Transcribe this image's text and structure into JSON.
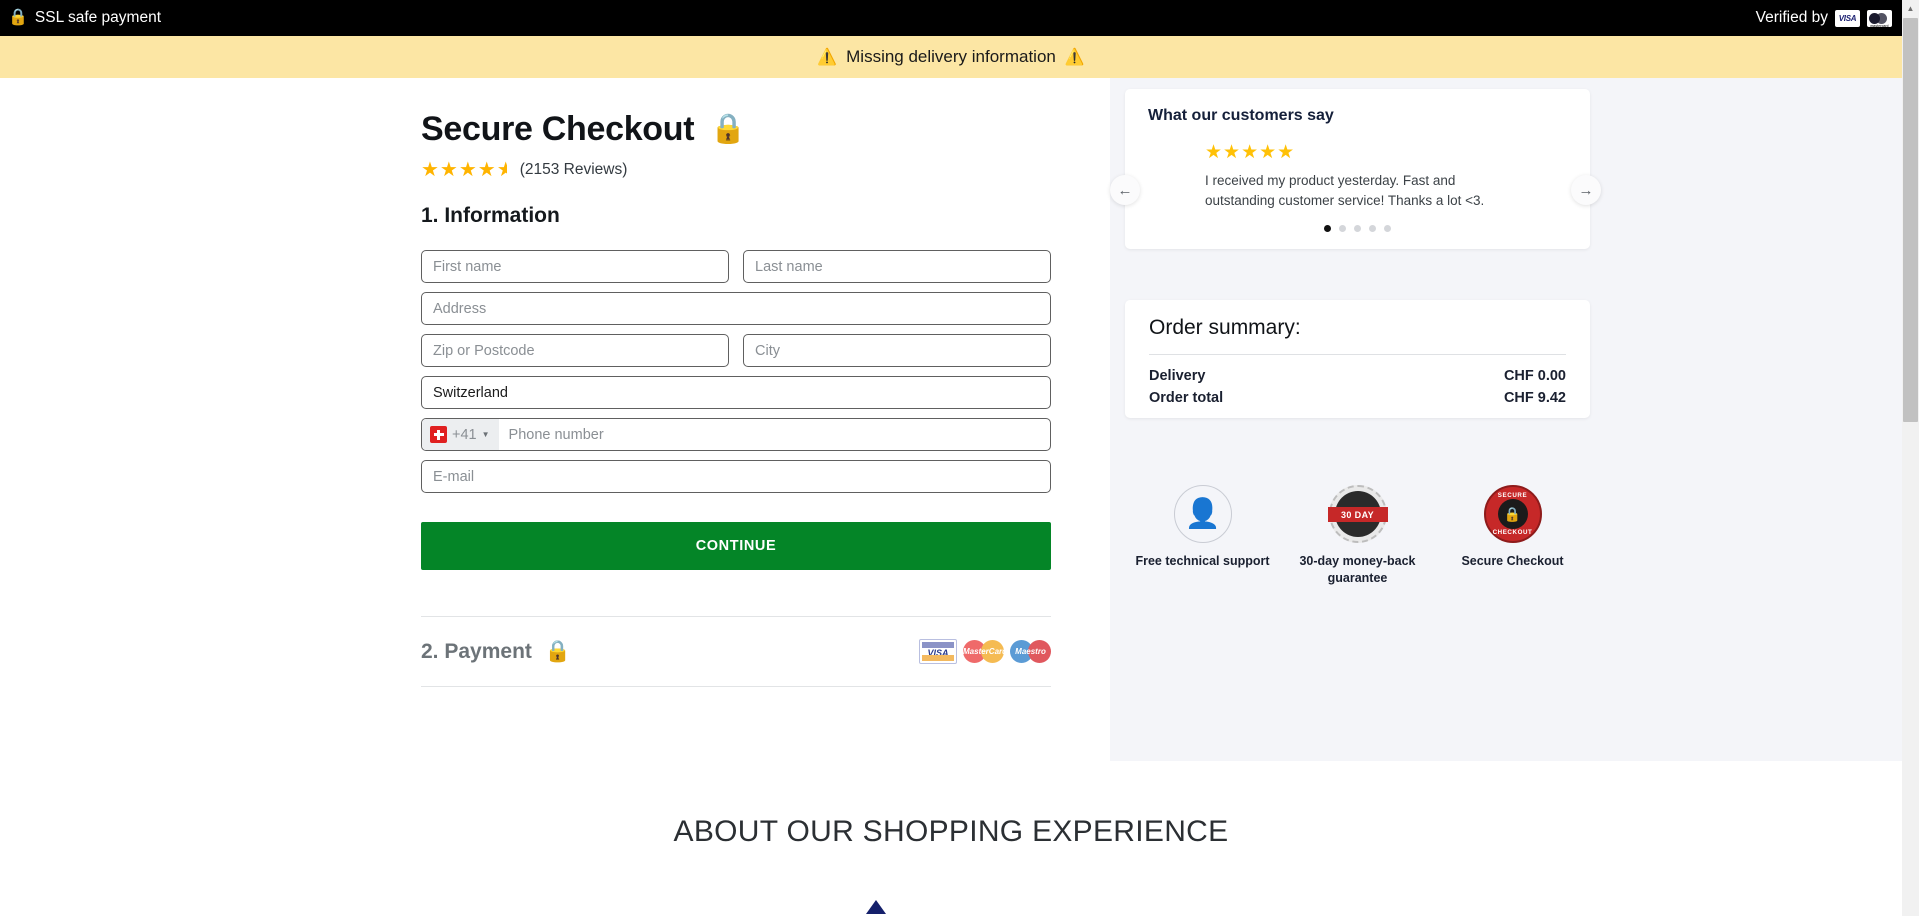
{
  "topbar": {
    "lock_icon": "lock-icon",
    "ssl_label": "SSL safe payment",
    "verified_label": "Verified by",
    "visa_badge": "VISA",
    "mastercard_badge": "mastercard"
  },
  "warning": {
    "left_icon": "warning-triangle-icon",
    "text": "Missing delivery information",
    "right_icon": "warning-triangle-icon",
    "background": "#fce6a4"
  },
  "checkout": {
    "title": "Secure Checkout",
    "title_lock_icon": "lock-icon",
    "rating_stars": 4.5,
    "reviews": "(2153 Reviews)",
    "step1_heading": "1. Information",
    "fields": {
      "first_name": "First name",
      "last_name": "Last name",
      "address": "Address",
      "zip": "Zip or Postcode",
      "city": "City",
      "country_value": "Switzerland",
      "phone_prefix": "+41",
      "phone_flag": "swiss-flag-icon",
      "phone_placeholder": "Phone number",
      "email": "E-mail"
    },
    "continue_label": "CONTINUE",
    "continue_color": "#048527",
    "step2_heading": "2. Payment",
    "step2_lock_icon": "lock-icon",
    "cards": [
      "VISA",
      "MasterCard",
      "Maestro"
    ]
  },
  "testimonial": {
    "title": "What our customers say",
    "stars": 5,
    "text": "I received my product yesterday. Fast and outstanding customer service! Thanks a lot <3.",
    "dots_total": 5,
    "dot_active_index": 0,
    "prev_icon": "arrow-left-icon",
    "next_icon": "arrow-right-icon"
  },
  "summary": {
    "title": "Order summary:",
    "rows": [
      {
        "label": "Delivery",
        "value": "CHF 0.00"
      },
      {
        "label": "Order total",
        "value": "CHF 9.42"
      }
    ]
  },
  "badges": [
    {
      "icon": "headset-support-icon",
      "caption": "Free technical support"
    },
    {
      "icon": "money-back-seal-icon",
      "caption": "30-day money-back guarantee",
      "band": "30 DAY"
    },
    {
      "icon": "secure-checkout-seal-icon",
      "caption": "Secure Checkout",
      "top_text": "SECURE",
      "bottom_text": "CHECKOUT"
    }
  ],
  "about": {
    "heading": "ABOUT OUR SHOPPING EXPERIENCE"
  },
  "scrollbar": {
    "up_icon": "scroll-up-arrow-icon"
  }
}
